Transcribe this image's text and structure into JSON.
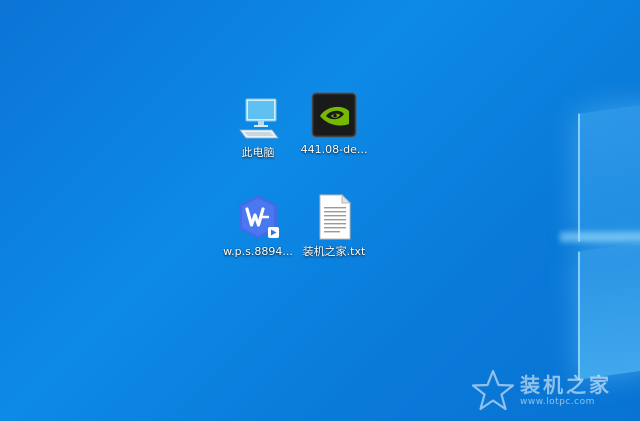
{
  "desktop": {
    "icons": [
      {
        "label": "此电脑",
        "icon": "this-pc-icon"
      },
      {
        "label": "441.08-de...",
        "icon": "nvidia-installer-icon"
      },
      {
        "label": "w.p.s.8894...",
        "icon": "wps-installer-icon"
      },
      {
        "label": "装机之家.txt",
        "icon": "text-file-icon"
      }
    ]
  },
  "watermark": {
    "name": "装机之家",
    "url": "www.lotpc.com"
  },
  "colors": {
    "desktop_background": "#0a7ad9",
    "nvidia_green": "#76b900",
    "wps_blue": "#3f6ce8"
  }
}
